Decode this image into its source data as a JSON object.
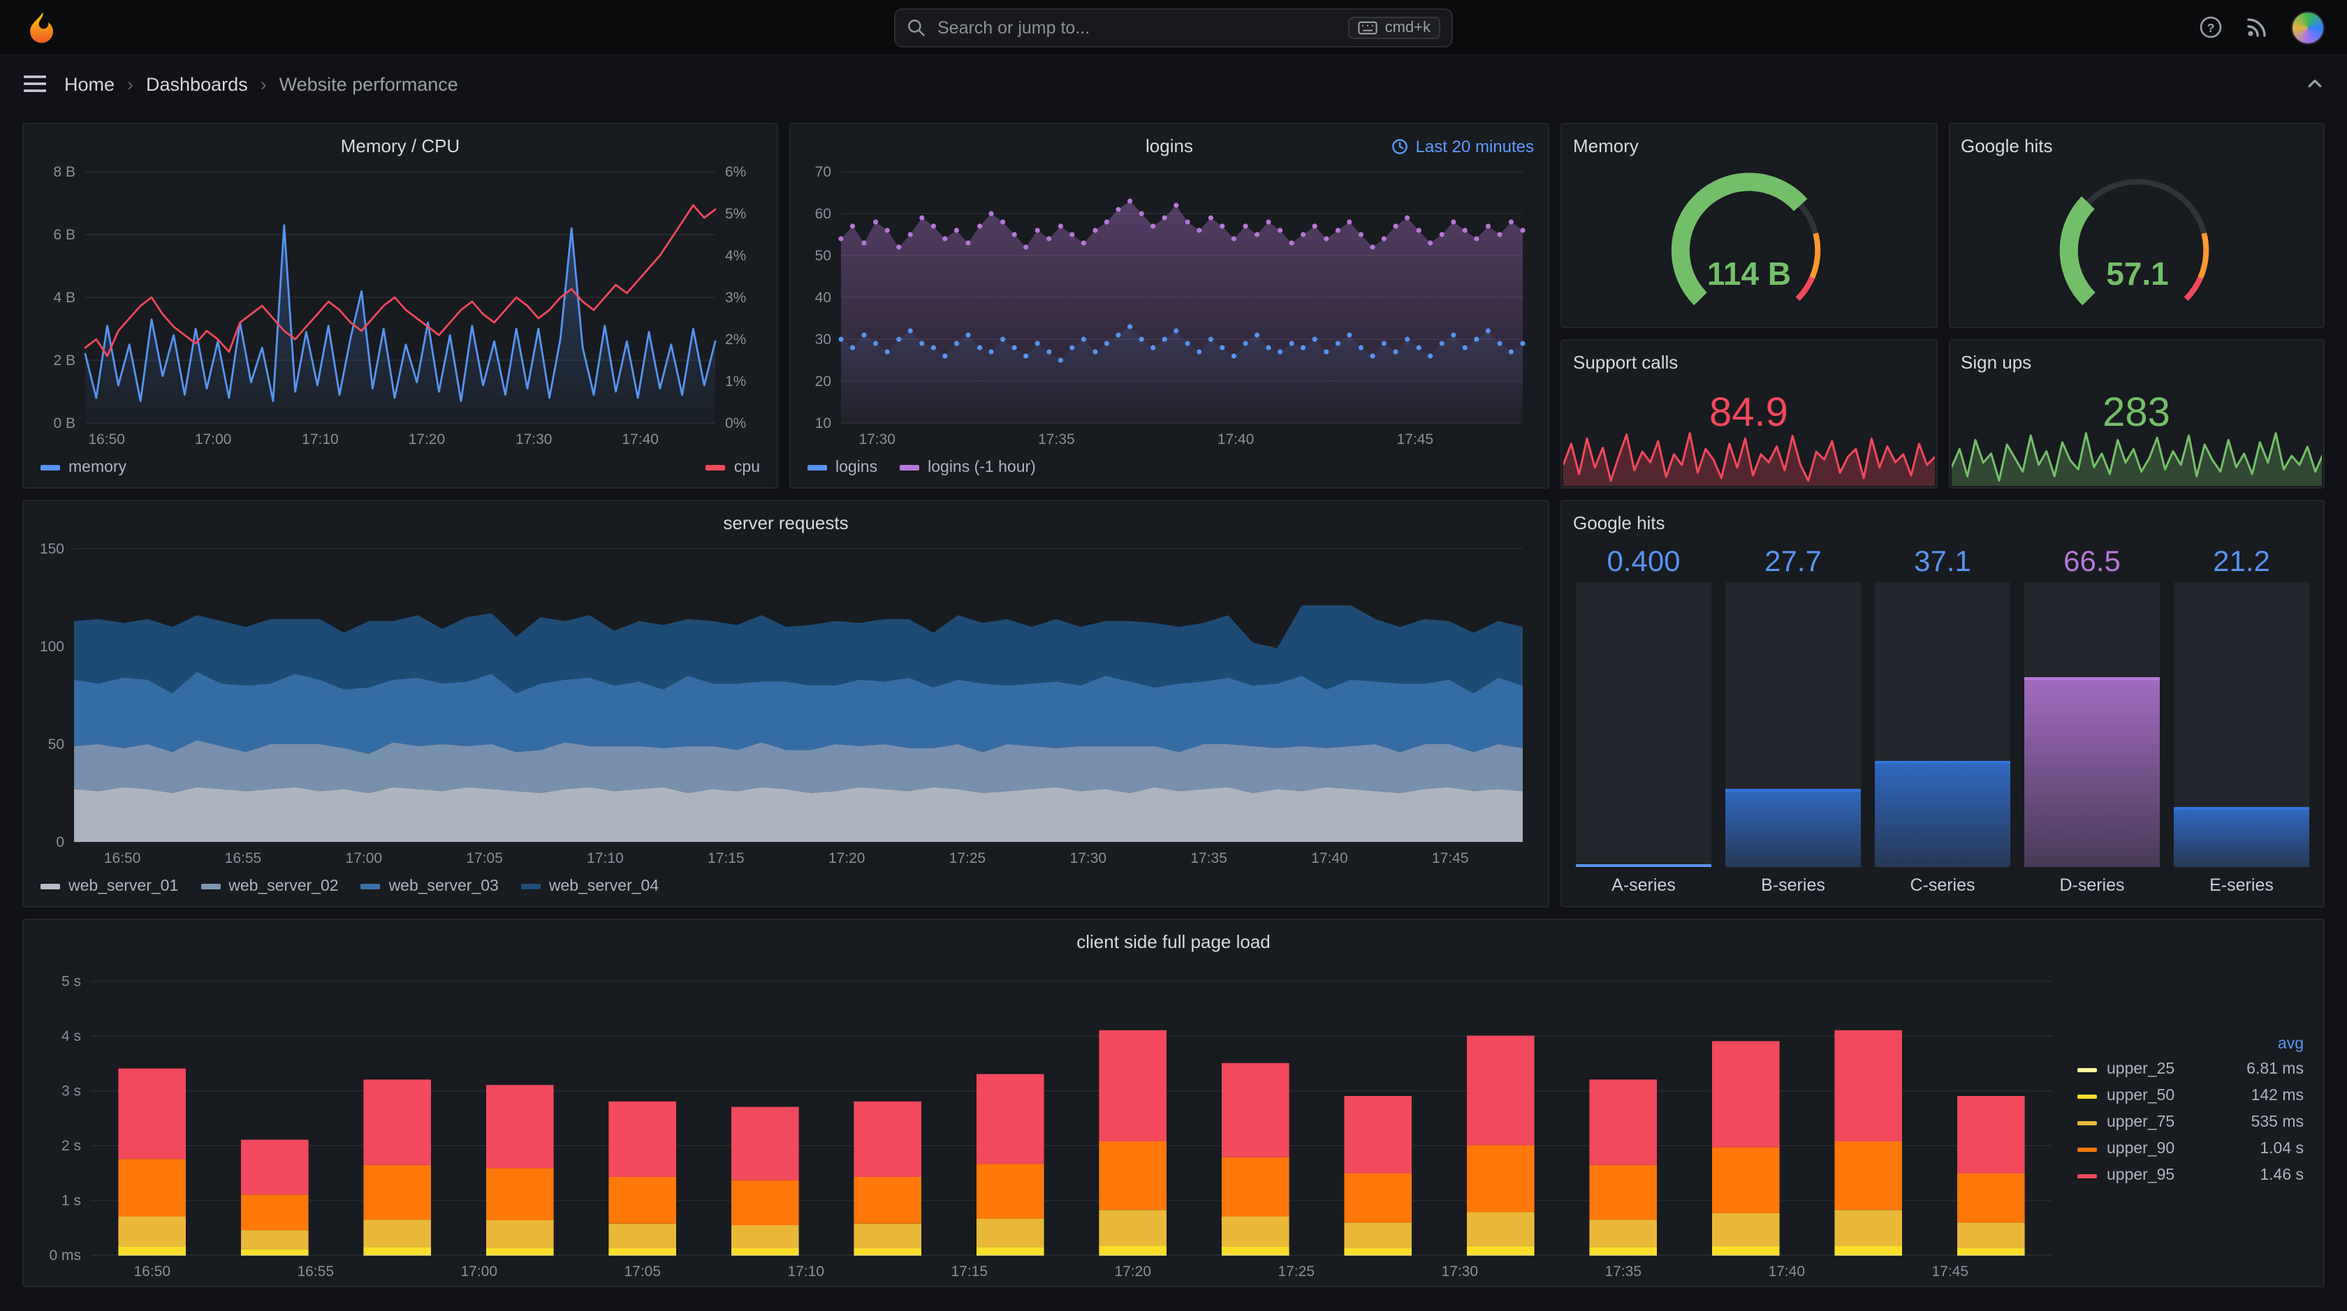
{
  "topbar": {
    "search_placeholder": "Search or jump to...",
    "shortcut_label": "cmd+k"
  },
  "breadcrumb": {
    "items": [
      "Home",
      "Dashboards",
      "Website performance"
    ]
  },
  "panels": {
    "memory_cpu": {
      "title": "Memory / CPU",
      "chart_data": {
        "type": "line",
        "x_tick_labels": [
          "16:50",
          "17:00",
          "17:10",
          "17:20",
          "17:30",
          "17:40"
        ],
        "y_left_ticks": [
          "0 B",
          "2 B",
          "4 B",
          "6 B",
          "8 B"
        ],
        "y_right_ticks": [
          "0%",
          "1%",
          "2%",
          "3%",
          "4%",
          "5%",
          "6%"
        ],
        "y_left_range": [
          0,
          8
        ],
        "y_right_range": [
          0,
          6
        ],
        "series": [
          {
            "name": "memory",
            "color": "#5794F2",
            "axis": "left",
            "values": [
              2.2,
              0.8,
              3.1,
              1.2,
              2.5,
              0.7,
              3.3,
              1.5,
              2.8,
              0.9,
              3.0,
              1.1,
              2.6,
              0.8,
              3.2,
              1.3,
              2.4,
              0.7,
              6.3,
              1.0,
              2.9,
              1.2,
              3.1,
              0.9,
              2.7,
              4.2,
              1.1,
              3.0,
              0.8,
              2.5,
              1.3,
              3.2,
              1.0,
              2.8,
              0.7,
              3.1,
              1.2,
              2.6,
              0.9,
              3.0,
              1.1,
              3.0,
              0.8,
              2.7,
              6.2,
              2.4,
              0.9,
              3.1,
              1.0,
              2.6,
              0.8,
              2.9,
              1.1,
              2.5,
              0.9,
              3.0,
              1.2,
              2.6
            ]
          },
          {
            "name": "cpu",
            "color": "#F2495C",
            "axis": "right",
            "values": [
              1.8,
              2.0,
              1.6,
              2.2,
              2.5,
              2.8,
              3.0,
              2.6,
              2.3,
              2.1,
              1.9,
              2.2,
              2.0,
              1.7,
              2.4,
              2.6,
              2.8,
              2.5,
              2.2,
              2.0,
              2.3,
              2.6,
              2.9,
              2.7,
              2.4,
              2.2,
              2.5,
              2.8,
              3.0,
              2.7,
              2.5,
              2.3,
              2.1,
              2.4,
              2.7,
              2.9,
              2.6,
              2.4,
              2.7,
              3.0,
              2.8,
              2.5,
              2.7,
              3.0,
              3.2,
              2.9,
              2.7,
              3.0,
              3.3,
              3.1,
              3.4,
              3.7,
              4.0,
              4.4,
              4.8,
              5.2,
              4.9,
              5.1
            ]
          }
        ]
      }
    },
    "logins": {
      "title": "logins",
      "time_range": "Last 20 minutes",
      "chart_data": {
        "type": "scatter",
        "x_tick_labels": [
          "17:30",
          "17:35",
          "17:40",
          "17:45"
        ],
        "y_ticks": [
          "10",
          "20",
          "30",
          "40",
          "50",
          "60",
          "70"
        ],
        "y_range": [
          10,
          70
        ],
        "series": [
          {
            "name": "logins",
            "color": "#5794F2",
            "values": [
              30,
              28,
              31,
              29,
              27,
              30,
              32,
              29,
              28,
              26,
              29,
              31,
              28,
              27,
              30,
              28,
              26,
              29,
              27,
              25,
              28,
              30,
              27,
              29,
              31,
              33,
              30,
              28,
              30,
              32,
              29,
              27,
              30,
              28,
              26,
              29,
              31,
              28,
              27,
              29,
              28,
              30,
              27,
              29,
              31,
              28,
              26,
              29,
              27,
              30,
              28,
              26,
              29,
              31,
              28,
              30,
              32,
              29,
              27,
              29
            ]
          },
          {
            "name": "logins (-1 hour)",
            "color": "#B877D9",
            "values": [
              54,
              57,
              53,
              58,
              56,
              52,
              55,
              59,
              57,
              54,
              56,
              53,
              57,
              60,
              58,
              55,
              52,
              56,
              54,
              57,
              55,
              53,
              56,
              58,
              61,
              63,
              60,
              57,
              59,
              62,
              58,
              56,
              59,
              57,
              54,
              57,
              55,
              58,
              56,
              53,
              55,
              57,
              54,
              56,
              58,
              55,
              52,
              54,
              57,
              59,
              56,
              53,
              55,
              58,
              56,
              54,
              57,
              55,
              58,
              56
            ]
          }
        ]
      }
    },
    "memory_gauge": {
      "title": "Memory",
      "value": "114 B",
      "color": "#73BF69",
      "fill_fraction": 0.68
    },
    "google_hits_gauge": {
      "title": "Google hits",
      "value": "57.1",
      "color": "#73BF69",
      "fill_fraction": 0.33
    },
    "support_calls": {
      "title": "Support calls",
      "value": "84.9",
      "color": "#F2495C",
      "sparkline": [
        72,
        88,
        65,
        92,
        70,
        85,
        60,
        78,
        95,
        68,
        82,
        74,
        90,
        63,
        80,
        72,
        96,
        66,
        84,
        76,
        62,
        88,
        70,
        92,
        64,
        80,
        74,
        86,
        68,
        94,
        72,
        60,
        82,
        76,
        90,
        66,
        78,
        84,
        62,
        92,
        70,
        86,
        74,
        80,
        64,
        88,
        72,
        78
      ]
    },
    "sign_ups": {
      "title": "Sign ups",
      "value": "283",
      "color": "#73BF69",
      "sparkline": [
        180,
        220,
        160,
        240,
        190,
        210,
        150,
        230,
        200,
        170,
        250,
        185,
        215,
        160,
        235,
        195,
        175,
        255,
        180,
        210,
        165,
        240,
        190,
        220,
        170,
        200,
        245,
        175,
        215,
        185,
        250,
        160,
        230,
        195,
        170,
        240,
        180,
        210,
        165,
        235,
        190,
        255,
        175,
        205,
        185,
        225,
        170,
        210
      ]
    },
    "server_requests": {
      "title": "server requests",
      "chart_data": {
        "type": "area",
        "stacked": true,
        "x_tick_labels": [
          "16:50",
          "16:55",
          "17:00",
          "17:05",
          "17:10",
          "17:15",
          "17:20",
          "17:25",
          "17:30",
          "17:35",
          "17:40",
          "17:45"
        ],
        "y_ticks": [
          "0",
          "50",
          "100",
          "150"
        ],
        "y_range": [
          0,
          150
        ],
        "series": [
          {
            "name": "web_server_01",
            "color": "#B4BDC9",
            "values": [
              27,
              26,
              28,
              27,
              25,
              28,
              27,
              26,
              27,
              28,
              26,
              27,
              25,
              28,
              27,
              26,
              28,
              27,
              26,
              25,
              27,
              28,
              26,
              27,
              28,
              25,
              27,
              26,
              28,
              27,
              25,
              26,
              28,
              27,
              26,
              28,
              27,
              25,
              26,
              27,
              28,
              26,
              27,
              25,
              28,
              26,
              27,
              28,
              25,
              27,
              26,
              28,
              27,
              26,
              25,
              27,
              28,
              26,
              27,
              26
            ]
          },
          {
            "name": "web_server_02",
            "color": "#7C97B5",
            "values": [
              22,
              24,
              20,
              23,
              21,
              24,
              22,
              20,
              23,
              22,
              24,
              21,
              20,
              23,
              22,
              24,
              21,
              23,
              20,
              22,
              24,
              21,
              23,
              22,
              20,
              24,
              22,
              21,
              23,
              20,
              22,
              24,
              21,
              23,
              22,
              20,
              23,
              21,
              24,
              22,
              20,
              23,
              22,
              24,
              21,
              20,
              23,
              22,
              24,
              21,
              23,
              20,
              22,
              24,
              21,
              23,
              22,
              20,
              23,
              22
            ]
          },
          {
            "name": "web_server_03",
            "color": "#3871AC",
            "values": [
              34,
              31,
              36,
              33,
              30,
              35,
              32,
              34,
              31,
              36,
              33,
              30,
              34,
              32,
              35,
              31,
              33,
              36,
              30,
              34,
              32,
              35,
              31,
              33,
              30,
              36,
              32,
              34,
              31,
              35,
              33,
              30,
              34,
              32,
              36,
              31,
              33,
              35,
              30,
              32,
              34,
              31,
              36,
              33,
              30,
              35,
              32,
              34,
              31,
              33,
              36,
              30,
              34,
              32,
              35,
              31,
              33,
              30,
              34,
              32
            ]
          },
          {
            "name": "web_server_04",
            "color": "#1F4E79",
            "values": [
              30,
              33,
              28,
              31,
              34,
              29,
              32,
              30,
              33,
              28,
              31,
              29,
              34,
              30,
              32,
              28,
              33,
              31,
              29,
              34,
              30,
              32,
              28,
              31,
              33,
              29,
              32,
              30,
              34,
              28,
              31,
              33,
              29,
              32,
              30,
              28,
              33,
              31,
              34,
              29,
              32,
              30,
              28,
              31,
              33,
              29,
              30,
              32,
              22,
              18,
              36,
              43,
              38,
              32,
              29,
              33,
              30,
              31,
              29,
              30
            ]
          }
        ]
      }
    },
    "google_hits_bars": {
      "title": "Google hits",
      "bars": [
        {
          "label": "A-series",
          "value": "0.400",
          "fraction": 0.004,
          "bar_color": "#5794F2",
          "value_color": "#5794F2"
        },
        {
          "label": "B-series",
          "value": "27.7",
          "fraction": 0.277,
          "bar_color": "#3274D9",
          "value_color": "#5794F2"
        },
        {
          "label": "C-series",
          "value": "37.1",
          "fraction": 0.371,
          "bar_color": "#3274D9",
          "value_color": "#5794F2"
        },
        {
          "label": "D-series",
          "value": "66.5",
          "fraction": 0.665,
          "bar_color": "#B877D9",
          "value_color": "#B877D9"
        },
        {
          "label": "E-series",
          "value": "21.2",
          "fraction": 0.212,
          "bar_color": "#3274D9",
          "value_color": "#5794F2"
        }
      ]
    },
    "client_load": {
      "title": "client side full page load",
      "chart_data": {
        "type": "bar",
        "stacked": true,
        "legend_header": "avg",
        "x_tick_labels": [
          "16:50",
          "16:55",
          "17:00",
          "17:05",
          "17:10",
          "17:15",
          "17:20",
          "17:25",
          "17:30",
          "17:35",
          "17:40",
          "17:45"
        ],
        "y_tick_labels": [
          "0 ms",
          "1 s",
          "2 s",
          "3 s",
          "4 s",
          "5 s"
        ],
        "y_range_seconds": [
          0,
          5.2
        ],
        "series": [
          {
            "name": "upper_25",
            "color": "#FFF899",
            "avg": "6.81 ms",
            "values": [
              0.007,
              0.007,
              0.007,
              0.007,
              0.007,
              0.007,
              0.007,
              0.007,
              0.007,
              0.007,
              0.007,
              0.007,
              0.007,
              0.007,
              0.007,
              0.007
            ]
          },
          {
            "name": "upper_50",
            "color": "#FADE2A",
            "avg": "142 ms",
            "values": [
              0.15,
              0.1,
              0.14,
              0.13,
              0.12,
              0.12,
              0.12,
              0.14,
              0.17,
              0.15,
              0.13,
              0.16,
              0.14,
              0.16,
              0.17,
              0.13
            ]
          },
          {
            "name": "upper_75",
            "color": "#EAB839",
            "avg": "535 ms",
            "values": [
              0.55,
              0.35,
              0.5,
              0.5,
              0.45,
              0.42,
              0.45,
              0.52,
              0.65,
              0.55,
              0.46,
              0.62,
              0.5,
              0.6,
              0.65,
              0.46
            ]
          },
          {
            "name": "upper_90",
            "color": "#FF780A",
            "avg": "1.04 s",
            "values": [
              1.05,
              0.65,
              1.0,
              0.95,
              0.85,
              0.82,
              0.85,
              1.0,
              1.25,
              1.08,
              0.9,
              1.22,
              1.0,
              1.2,
              1.25,
              0.9
            ]
          },
          {
            "name": "upper_95",
            "color": "#F2495C",
            "avg": "1.46 s",
            "values": [
              1.65,
              1.0,
              1.56,
              1.52,
              1.38,
              1.34,
              1.38,
              1.64,
              2.03,
              1.72,
              1.41,
              2.0,
              1.56,
              1.94,
              2.03,
              1.41
            ]
          }
        ]
      }
    }
  }
}
